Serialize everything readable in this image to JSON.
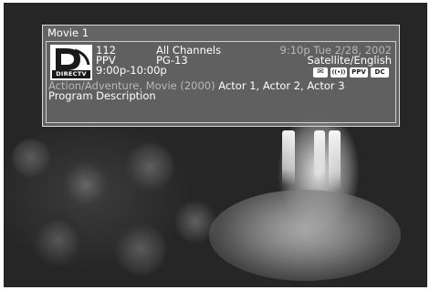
{
  "panel": {
    "title": "Movie 1",
    "logo_text": "DIRECTV",
    "channel_number": "112",
    "channel_type": "PPV",
    "time_slot": "9:00p-10:00p",
    "channel_group": "All Channels",
    "rating": "PG-13",
    "current_time": "9:10p Tue 2/28, 2002",
    "audio": "Satellite/English",
    "genre": "Action/Adventure, Movie (2000)",
    "actors": "Actor 1, Actor 2, Actor 3",
    "description": "Program Description",
    "icons": [
      {
        "name": "mail-icon",
        "label": "✉"
      },
      {
        "name": "broadcast-icon",
        "label": "((•))"
      },
      {
        "name": "ppv-icon",
        "label": "PPV"
      },
      {
        "name": "dolby-icon",
        "label": "DC"
      }
    ]
  }
}
